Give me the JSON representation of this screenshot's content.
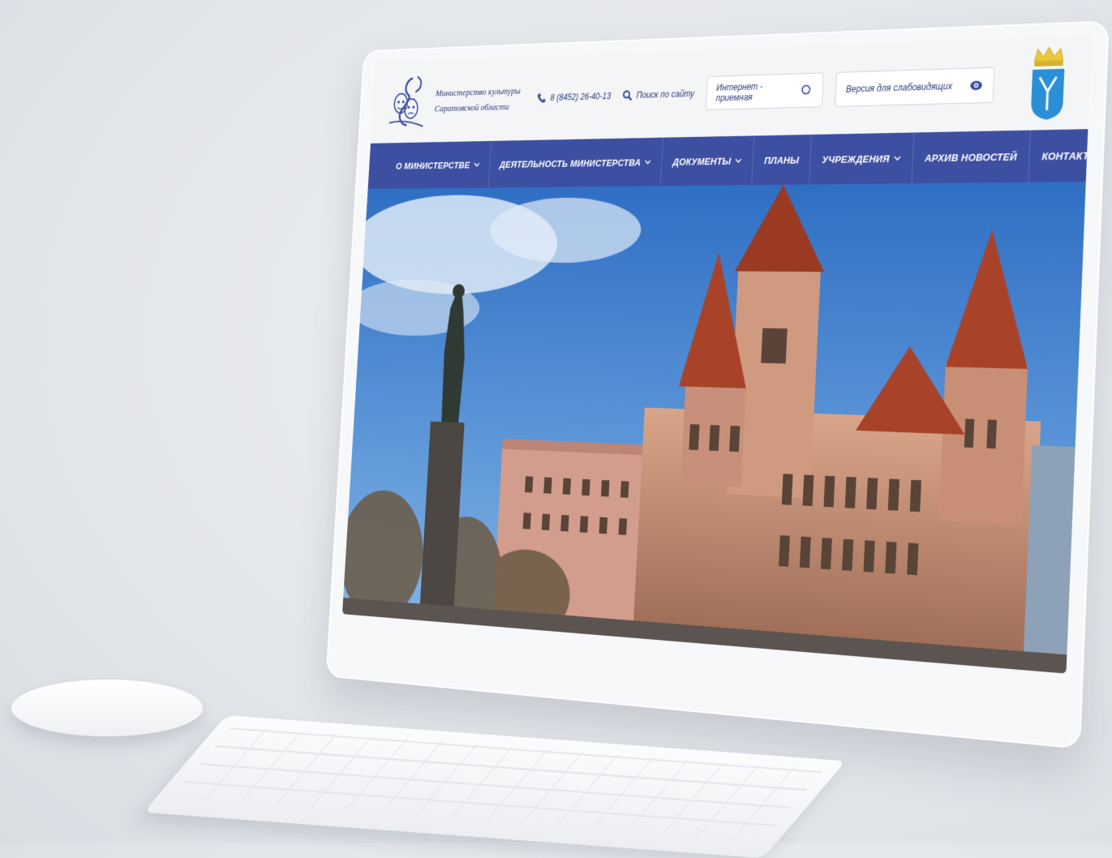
{
  "header": {
    "logo_line1": "Министерство культуры",
    "logo_line2": "Саратовской области",
    "phone": "8 (8452) 26-40-13",
    "search_label": "Поиск по сайту",
    "reception_label": "Интернет - приемная",
    "vision_label": "Версия для слабовидящих"
  },
  "nav": {
    "items": [
      {
        "label": "О МИНИСТЕРСТВЕ",
        "dropdown": true
      },
      {
        "label": "ДЕЯТЕЛЬНОСТЬ МИНИСТЕРСТВА",
        "dropdown": true
      },
      {
        "label": "ДОКУМЕНТЫ",
        "dropdown": true
      },
      {
        "label": "ПЛАНЫ",
        "dropdown": false
      },
      {
        "label": "УЧРЕЖДЕНИЯ",
        "dropdown": true
      },
      {
        "label": "АРХИВ НОВОСТЕЙ",
        "dropdown": false
      },
      {
        "label": "КОНТАКТЫ",
        "dropdown": false
      }
    ]
  },
  "icons": {
    "phone": "phone-icon",
    "search": "search-icon",
    "reception": "chat-bubble-icon",
    "vision": "eye-icon",
    "dropdown": "chevron-down-icon"
  },
  "colors": {
    "brand": "#3d4fa1",
    "text": "#2c3a78",
    "coat_blue": "#2a8fd6",
    "crown": "#e9c93a"
  }
}
